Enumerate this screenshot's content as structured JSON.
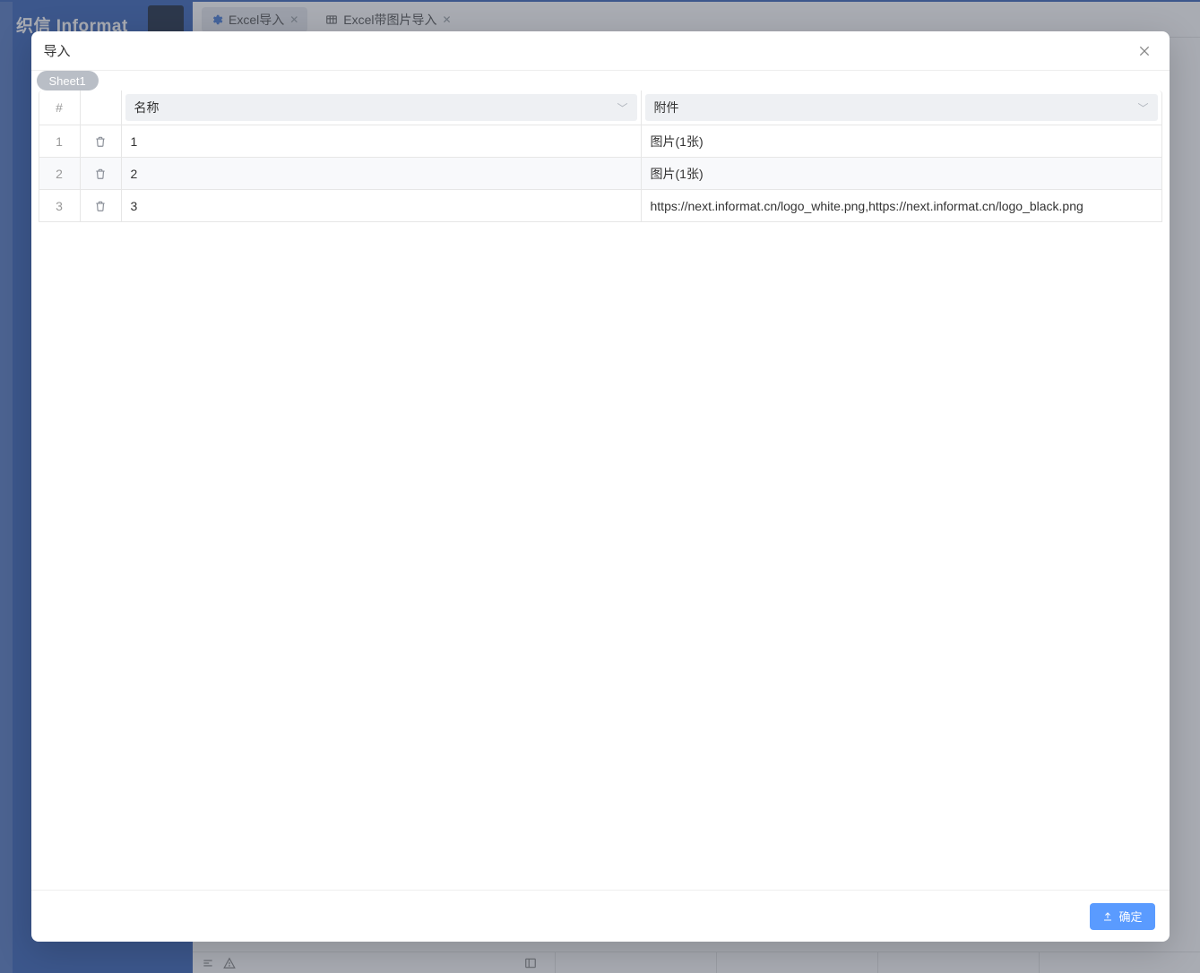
{
  "brand": {
    "name": "织信 Informat"
  },
  "tabs": [
    {
      "label": "Excel导入",
      "active": true
    },
    {
      "label": "Excel带图片导入",
      "active": false
    }
  ],
  "modal": {
    "title": "导入",
    "sheet_tab": "Sheet1",
    "columns": {
      "index": "#",
      "name": "名称",
      "attachment": "附件"
    },
    "rows": [
      {
        "idx": "1",
        "name": "1",
        "attachment": "图片(1张)"
      },
      {
        "idx": "2",
        "name": "2",
        "attachment": "图片(1张)"
      },
      {
        "idx": "3",
        "name": "3",
        "attachment": "https://next.informat.cn/logo_white.png,https://next.informat.cn/logo_black.png"
      }
    ],
    "confirm_label": "确定"
  }
}
